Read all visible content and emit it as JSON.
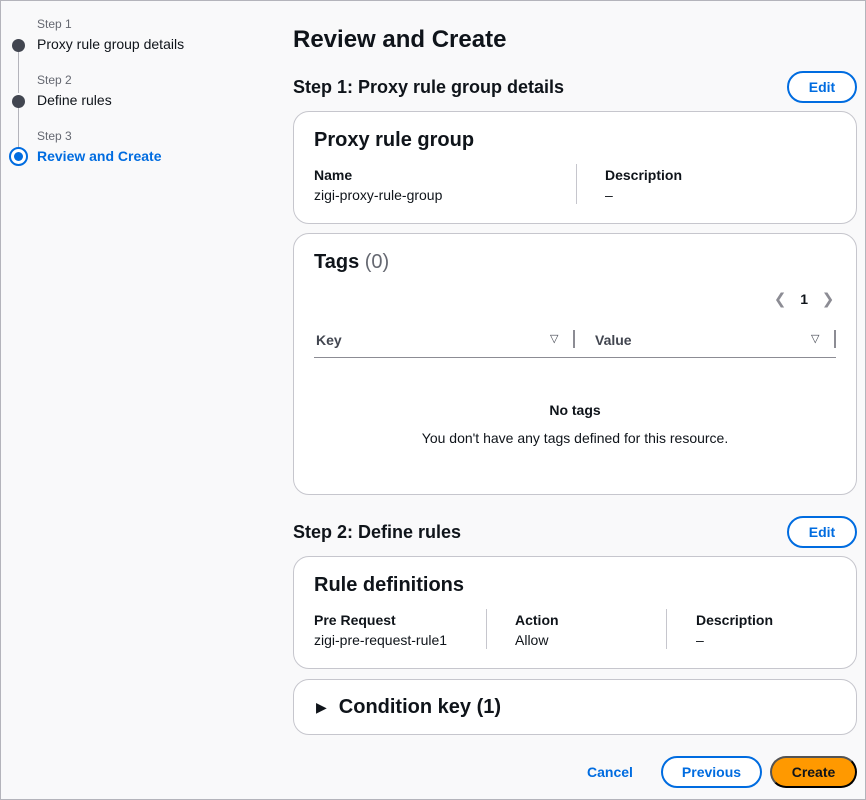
{
  "wizard": {
    "steps": [
      {
        "number": "Step 1",
        "title": "Proxy rule group details"
      },
      {
        "number": "Step 2",
        "title": "Define rules"
      },
      {
        "number": "Step 3",
        "title": "Review and Create"
      }
    ],
    "active_step": 3
  },
  "page_title": "Review and Create",
  "step1": {
    "header": "Step 1: Proxy rule group details",
    "edit_label": "Edit",
    "group_card": {
      "title": "Proxy rule group",
      "name_label": "Name",
      "name_value": "zigi-proxy-rule-group",
      "description_label": "Description",
      "description_value": "–"
    },
    "tags_card": {
      "title": "Tags",
      "count": "(0)",
      "pagination": {
        "prev_icon": "chevron-left-icon",
        "page": "1",
        "next_icon": "chevron-right-icon"
      },
      "columns": [
        "Key",
        "Value"
      ],
      "empty_title": "No tags",
      "empty_desc": "You don't have any tags defined for this resource."
    }
  },
  "step2": {
    "header": "Step 2: Define rules",
    "edit_label": "Edit",
    "rules_card": {
      "title": "Rule definitions",
      "columns": [
        {
          "label": "Pre Request",
          "value": "zigi-pre-request-rule1"
        },
        {
          "label": "Action",
          "value": "Allow"
        },
        {
          "label": "Description",
          "value": "–"
        }
      ]
    },
    "condition_expander": {
      "label": "Condition key (1)",
      "expanded": false
    }
  },
  "footer": {
    "cancel_label": "Cancel",
    "previous_label": "Previous",
    "create_label": "Create"
  },
  "colors": {
    "accent": "#006ce0",
    "primary_button": "#ff9900",
    "border": "#c6c6cd"
  }
}
